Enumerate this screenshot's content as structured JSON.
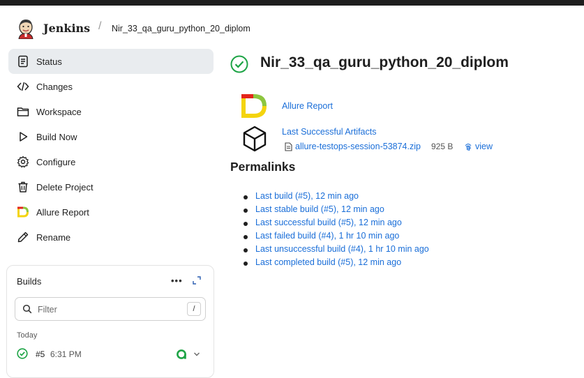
{
  "header": {
    "brand": "Jenkins",
    "separator": "/",
    "breadcrumb": "Nir_33_qa_guru_python_20_diplom"
  },
  "sidebar": {
    "items": [
      {
        "label": "Status",
        "icon": "status-icon",
        "active": true
      },
      {
        "label": "Changes",
        "icon": "code-icon"
      },
      {
        "label": "Workspace",
        "icon": "folder-icon"
      },
      {
        "label": "Build Now",
        "icon": "play-icon"
      },
      {
        "label": "Configure",
        "icon": "gear-icon"
      },
      {
        "label": "Delete Project",
        "icon": "trash-icon"
      },
      {
        "label": "Allure Report",
        "icon": "allure-icon"
      },
      {
        "label": "Rename",
        "icon": "pencil-icon"
      }
    ]
  },
  "builds": {
    "title": "Builds",
    "more": "•••",
    "filter_placeholder": "Filter",
    "filter_shortcut": "/",
    "group": "Today",
    "items": [
      {
        "number": "#5",
        "time": "6:31 PM",
        "status": "success"
      }
    ]
  },
  "main": {
    "title": "Nir_33_qa_guru_python_20_diplom",
    "allure_link": "Allure Report",
    "artifacts_link": "Last Successful Artifacts",
    "artifact": {
      "name": "allure-testops-session-53874.zip",
      "size": "925 B",
      "view": "view"
    },
    "permalinks_title": "Permalinks",
    "permalinks": [
      "Last build (#5), 12 min ago",
      "Last stable build (#5), 12 min ago",
      "Last successful build (#5), 12 min ago",
      "Last failed build (#4), 1 hr 10 min ago",
      "Last unsuccessful build (#4), 1 hr 10 min ago",
      "Last completed build (#5), 12 min ago"
    ]
  },
  "colors": {
    "link": "#1a6ed8",
    "success": "#1ea446",
    "active_bg": "#e9ecef",
    "allure_yellow": "#f4d40e",
    "allure_red": "#e3241b",
    "allure_green": "#8dc63f"
  }
}
